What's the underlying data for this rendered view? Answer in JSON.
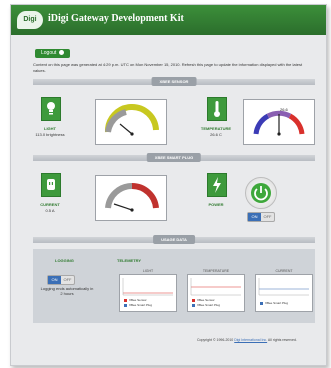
{
  "header": {
    "logo_text": "Digi",
    "title": "iDigi Gateway Development Kit"
  },
  "logout": {
    "label": "Logout"
  },
  "intro_note": "Content on this page was generated at 4:29 p.m. UTC on Mon November 15, 2010. Refresh this page to update the information displayed with the latest values.",
  "sections": {
    "sensor": "XBEE SENSOR",
    "smart_plug": "XBEE SMART PLUG",
    "usage": "USAGE DATA"
  },
  "sensor": {
    "light": {
      "label": "LIGHT",
      "value": "113.0 brightness",
      "gauge_level": 0.42
    },
    "temperature": {
      "label": "TEMPERATURE",
      "value": "26.6 C",
      "gauge_level": 0.48,
      "gauge_text": "26.6"
    }
  },
  "smart_plug": {
    "current": {
      "label": "CURRENT",
      "value": "0.5 A",
      "gauge_level": 0.2
    },
    "power": {
      "label": "POWER"
    },
    "toggle": {
      "on": "ON",
      "off": "OFF"
    }
  },
  "usage": {
    "logging": {
      "title": "LOGGING",
      "toggle": {
        "on": "ON",
        "off": "OFF"
      },
      "note": "Logging ends automatically in 2 hours"
    },
    "telemetry_title": "TELEMETRY",
    "charts": [
      {
        "title": "LIGHT",
        "legend": [
          {
            "label": "XBee Sensor",
            "color": "#d9302c"
          },
          {
            "label": "XBee Smart Plug",
            "color": "#3b6fb6"
          }
        ]
      },
      {
        "title": "TEMPERATURE",
        "legend": [
          {
            "label": "XBee Sensor",
            "color": "#d9302c"
          },
          {
            "label": "XBee Smart Plug",
            "color": "#3b6fb6"
          }
        ]
      },
      {
        "title": "CURRENT",
        "legend": [
          {
            "label": "XBee Smart Plug",
            "color": "#3b6fb6"
          }
        ]
      }
    ]
  },
  "footer": {
    "copyright_prefix": "Copyright © 1996-2010",
    "company": "Digi International Inc.",
    "suffix": "All rights reserved."
  },
  "colors": {
    "accent_green": "#3e9a3c",
    "toggle_blue": "#3b6fb6",
    "legend_red": "#d9302c"
  }
}
